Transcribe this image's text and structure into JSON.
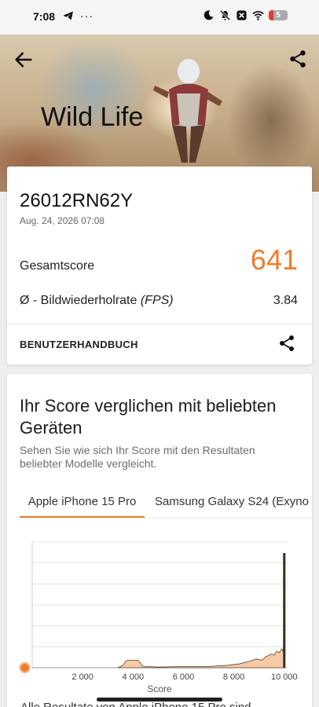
{
  "status_bar": {
    "time": "7:08",
    "left_icons": [
      "telegram-icon",
      "more-notifications-icon"
    ],
    "right_icons": [
      "moon-icon",
      "mute-icon",
      "close-box-icon",
      "wifi-icon"
    ],
    "battery_level": "5",
    "battery_color": "#e53935"
  },
  "hero": {
    "title": "Wild Life"
  },
  "result": {
    "device_name": "26012RN62Y",
    "timestamp": "Aug. 24, 2026 07:08",
    "score_label": "Gesamtscore",
    "score_value": "641",
    "fps_label_prefix": "Ø - Bildwiederholrate ",
    "fps_label_unit": "(FPS)",
    "fps_value": "3.84",
    "manual_label": "BENUTZERHANDBUCH"
  },
  "compare": {
    "title": "Ihr Score verglichen mit beliebten Geräten",
    "description": "Sehen Sie wie sich Ihr Score mit den Resultaten beliebter Modelle vergleicht.",
    "tabs": [
      "Apple iPhone 15 Pro",
      "Samsung Galaxy S24 (Exyno"
    ],
    "active_tab": 0
  },
  "bottom_peek_text": "Alle Resultate von Apple iPhone 15 Pro sind",
  "colors": {
    "accent": "#f07c2a",
    "chart_fill": "#f7c9a4"
  },
  "chart_data": {
    "type": "area",
    "xlabel": "Score",
    "ylabel": "",
    "x_ticks": [
      "2 000",
      "4 000",
      "6 000",
      "8 000",
      "10 000"
    ],
    "x_tick_values": [
      2000,
      4000,
      6000,
      8000,
      10000
    ],
    "xlim": [
      0,
      10100
    ],
    "ylim": [
      0,
      1
    ],
    "grid": true,
    "your_score": 641,
    "distribution": {
      "x": [
        3400,
        3600,
        3700,
        3800,
        4000,
        4200,
        4400,
        5000,
        6000,
        7000,
        7800,
        8200,
        8600,
        8900,
        9100,
        9300,
        9500,
        9600,
        9700,
        9800,
        9900,
        9950,
        10000
      ],
      "y": [
        0.0,
        0.02,
        0.05,
        0.06,
        0.06,
        0.06,
        0.01,
        0.005,
        0.01,
        0.01,
        0.02,
        0.03,
        0.05,
        0.07,
        0.06,
        0.09,
        0.11,
        0.1,
        0.13,
        0.12,
        0.15,
        0.13,
        0.2
      ]
    },
    "highlight_score": 10000
  }
}
